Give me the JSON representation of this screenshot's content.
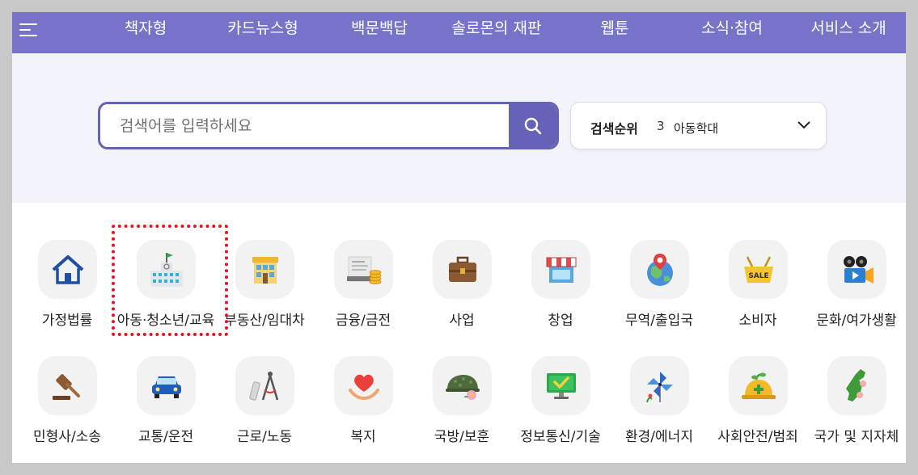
{
  "nav": {
    "items": [
      {
        "label": "책자형"
      },
      {
        "label": "카드뉴스형"
      },
      {
        "label": "백문백답"
      },
      {
        "label": "솔로몬의 재판"
      },
      {
        "label": "웹툰"
      },
      {
        "label": "소식·참여"
      },
      {
        "label": "서비스 소개"
      }
    ]
  },
  "search": {
    "placeholder": "검색어를 입력하세요",
    "value": ""
  },
  "ranking": {
    "label": "검색순위",
    "rank": "3",
    "term": "아동학대"
  },
  "categories": [
    {
      "label": "가정법률",
      "icon": "house-icon"
    },
    {
      "label": "아동·청소년/교육",
      "icon": "school-icon"
    },
    {
      "label": "부동산/임대차",
      "icon": "building-icon"
    },
    {
      "label": "금융/금전",
      "icon": "coins-icon"
    },
    {
      "label": "사업",
      "icon": "briefcase-icon"
    },
    {
      "label": "창업",
      "icon": "storefront-icon"
    },
    {
      "label": "무역/출입국",
      "icon": "globe-pin-icon"
    },
    {
      "label": "소비자",
      "icon": "sale-basket-icon"
    },
    {
      "label": "문화/여가생활",
      "icon": "movie-camera-icon"
    },
    {
      "label": "민형사/소송",
      "icon": "gavel-icon"
    },
    {
      "label": "교통/운전",
      "icon": "car-icon"
    },
    {
      "label": "근로/노동",
      "icon": "compass-tool-icon"
    },
    {
      "label": "복지",
      "icon": "heart-hands-icon"
    },
    {
      "label": "국방/보훈",
      "icon": "helmet-flower-icon"
    },
    {
      "label": "정보통신/기술",
      "icon": "monitor-check-icon"
    },
    {
      "label": "환경/에너지",
      "icon": "pinwheel-icon"
    },
    {
      "label": "사회안전/범죄",
      "icon": "hardhat-icon"
    },
    {
      "label": "국가 및 지자체",
      "icon": "korea-map-icon"
    }
  ],
  "colors": {
    "nav_bg": "#7674c9",
    "accent": "#6563b8",
    "hero_bg": "#f3f3fc",
    "highlight": "#e8121c"
  }
}
